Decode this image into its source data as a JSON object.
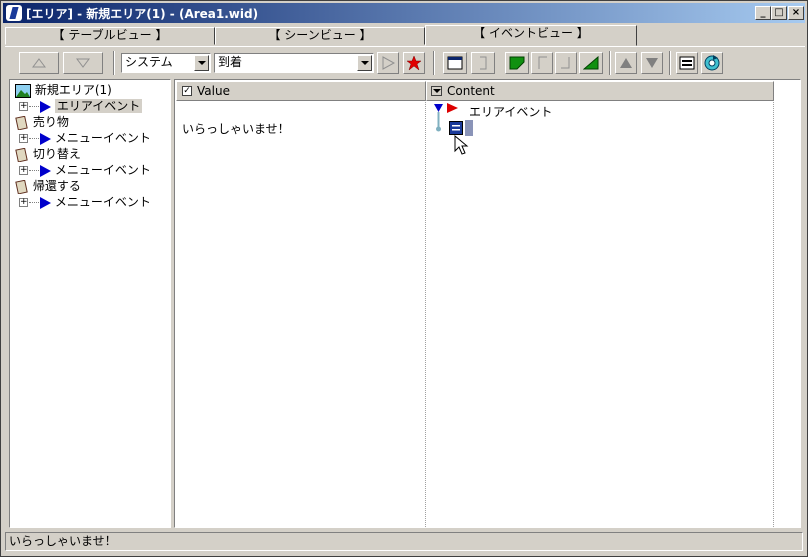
{
  "window": {
    "title": "[エリア] - 新規エリア(1) - (Area1.wid)",
    "controls": {
      "minimize": "_",
      "maximize": "□",
      "close": "×"
    }
  },
  "tabs": [
    {
      "label": "【 テーブルビュー 】",
      "active": false
    },
    {
      "label": "【 シーンビュー 】",
      "active": false
    },
    {
      "label": "【 イベントビュー 】",
      "active": true
    }
  ],
  "toolbar": {
    "category_select": "システム",
    "event_select": "到着"
  },
  "tree": {
    "root": "新規エリア(1)",
    "items": [
      {
        "label": "エリアイベント",
        "type": "event",
        "selected": true
      },
      {
        "label": "売り物",
        "type": "object"
      },
      {
        "label": "メニューイベント",
        "type": "event"
      },
      {
        "label": "切り替え",
        "type": "object"
      },
      {
        "label": "メニューイベント",
        "type": "event"
      },
      {
        "label": "帰還する",
        "type": "object"
      },
      {
        "label": "メニューイベント",
        "type": "event"
      }
    ]
  },
  "columns": {
    "value_header": "Value",
    "content_header": "Content"
  },
  "value_text": "いらっしゃいませ！",
  "content_event_label": "エリアイベント",
  "statusbar_text": "いらっしゃいませ！",
  "colors": {
    "title_start": "#0a246a",
    "title_end": "#a6caf0",
    "selection": "#d4d0c8",
    "event_arrow": "#0000cc",
    "flag_red": "#cc0000"
  }
}
